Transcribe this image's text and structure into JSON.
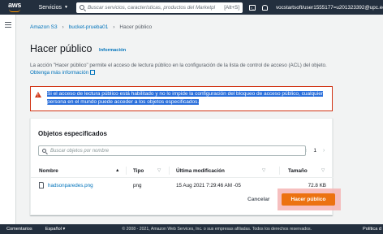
{
  "topnav": {
    "logo": "aws",
    "services_label": "Servicios",
    "search_placeholder": "Buscar servicios, características, productos del Marketpl",
    "search_shortcut": "[Alt+S]",
    "terminal_icon": "cloudshell-icon",
    "bell_icon": "notifications-icon",
    "user": "vocstartsoft/user1555177=u201323392@upc.edu"
  },
  "breadcrumb": {
    "items": [
      "Amazon S3",
      "bucket-prueba01",
      "Hacer público"
    ]
  },
  "page": {
    "title": "Hacer público",
    "info_label": "Información",
    "description": "La acción \"Hacer público\" permite el acceso de lectura público en la configuración de la lista de control de acceso (ACL) del objeto. ",
    "description_link": "Obtenga más información"
  },
  "warning": {
    "text": "Si el acceso de lectura público está habilitado y no lo impide la configuración del bloqueo de acceso público, cualquier persona en el mundo puede acceder a los objetos especificados."
  },
  "objects": {
    "heading": "Objetos especificados",
    "search_placeholder": "Buscar objetos por nombre",
    "page": "1",
    "columns": [
      "Nombre",
      "Tipo",
      "Última modificación",
      "Tamaño"
    ],
    "rows": [
      {
        "name": "hadsonparedes.png",
        "type": "png",
        "modified": "15 Aug 2021 7:29:46 AM -05",
        "size": "72.8 KB"
      }
    ]
  },
  "actions": {
    "cancel": "Cancelar",
    "primary": "Hacer público"
  },
  "footer": {
    "comments": "Comentarios",
    "language": "Español",
    "copyright": "© 2008 - 2021, Amazon Web Services, Inc. o sus empresas afiliadas. Todos los derechos reservados.",
    "last": "Política d"
  },
  "colors": {
    "nav": "#232f3e",
    "link": "#0073bb",
    "primary": "#ec7211",
    "error": "#d13212"
  }
}
